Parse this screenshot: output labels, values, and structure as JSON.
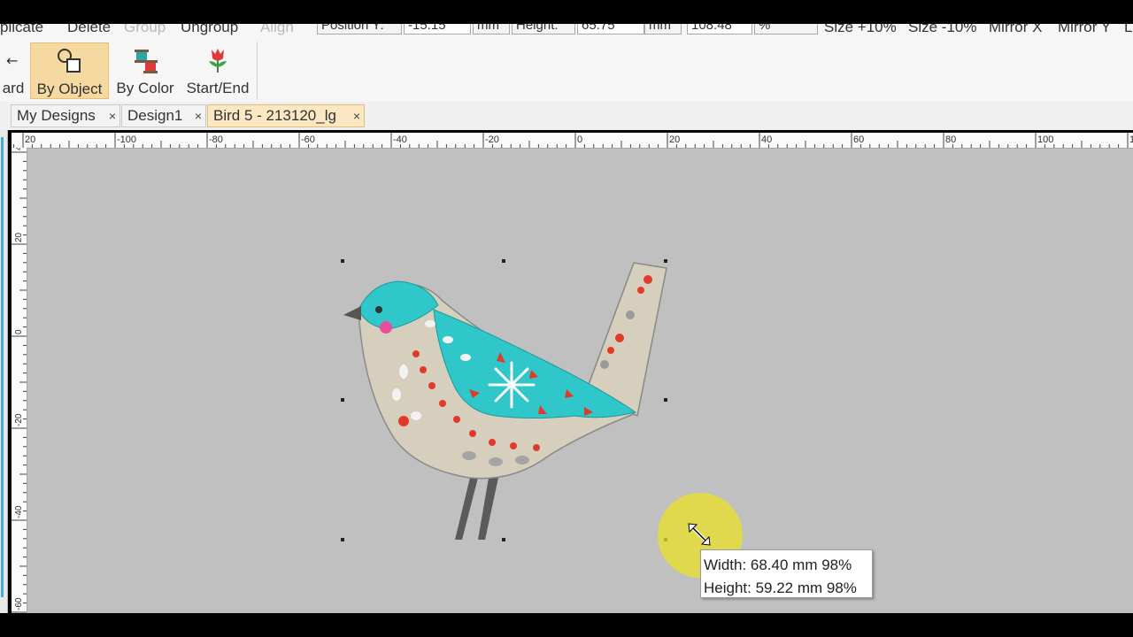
{
  "toolbar": {
    "duplicate_label": "plicate",
    "delete_label": "Delete",
    "group_label": "Group",
    "ungroup_label": "Ungroup",
    "align_label": "Align",
    "position_y_label": "Position Y:",
    "position_y_value": "-15.15",
    "unit_1": "mm",
    "height_label": "Height:",
    "height_value": "65.75",
    "unit_2": "mm",
    "scale_value": "108.48",
    "percent_unit": "%",
    "size_up_label": "Size +10%",
    "size_down_label": "Size -10%",
    "mirror_x_label": "Mirror X",
    "mirror_y_label": "Mirror Y",
    "cut_label": "L"
  },
  "ribbon": {
    "forward_label": "ard",
    "by_object_label": "By Object",
    "by_color_label": "By Color",
    "start_end_label": "Start/End"
  },
  "tabs": [
    {
      "label": "My Designs"
    },
    {
      "label": "Design1"
    },
    {
      "label": "Bird 5 - 213120_lg"
    }
  ],
  "close_glyph": "×",
  "ruler": {
    "h_ticks": [
      {
        "label": "20",
        "v": -120
      },
      {
        "label": "-100",
        "v": -100
      },
      {
        "label": "-80",
        "v": -80
      },
      {
        "label": "-60",
        "v": -60
      },
      {
        "label": "-40",
        "v": -40
      },
      {
        "label": "-20",
        "v": -20
      },
      {
        "label": "0",
        "v": 0
      },
      {
        "label": "20",
        "v": 20
      },
      {
        "label": "40",
        "v": 40
      },
      {
        "label": "60",
        "v": 60
      },
      {
        "label": "80",
        "v": 80
      },
      {
        "label": "100",
        "v": 100
      },
      {
        "label": "1",
        "v": 120
      }
    ],
    "v_ticks": [
      {
        "label": "40",
        "v": 40
      },
      {
        "label": "20",
        "v": 20
      },
      {
        "label": "0",
        "v": 0
      },
      {
        "label": "-20",
        "v": -20
      },
      {
        "label": "-40",
        "v": -40
      },
      {
        "label": "-60",
        "v": -60
      }
    ]
  },
  "tooltip": {
    "width_text": "Width: 68.40 mm 98%",
    "height_text": "Height: 59.22 mm 98%"
  },
  "colors": {
    "canvas": "#c0c0c0",
    "active_tab": "#fbe7c2",
    "active_button": "#f5d9a0",
    "bird_turquoise": "#2fc7c9",
    "bird_red": "#e23a2a",
    "bird_beige": "#d6cfbd",
    "highlight": "#ebe128"
  },
  "icons": {
    "by_object": "shapes-icon",
    "by_color": "spools-icon",
    "start_end": "flower-pin-icon",
    "resize_cursor": "resize-diagonal-icon"
  }
}
